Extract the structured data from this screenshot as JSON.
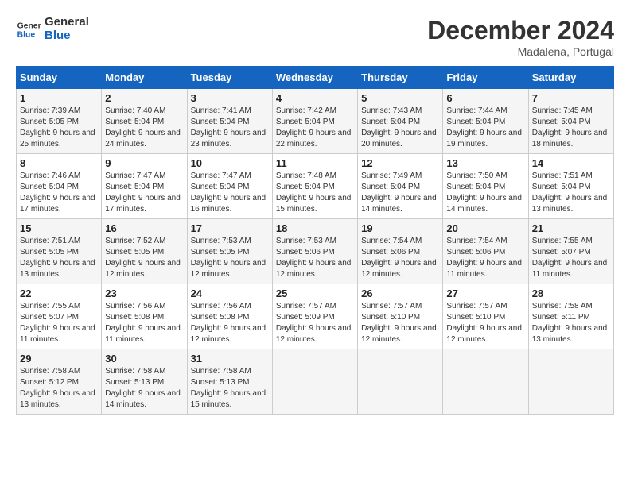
{
  "logo": {
    "text_general": "General",
    "text_blue": "Blue"
  },
  "title": "December 2024",
  "subtitle": "Madalena, Portugal",
  "days_of_week": [
    "Sunday",
    "Monday",
    "Tuesday",
    "Wednesday",
    "Thursday",
    "Friday",
    "Saturday"
  ],
  "weeks": [
    [
      {
        "day": "1",
        "sunrise": "Sunrise: 7:39 AM",
        "sunset": "Sunset: 5:05 PM",
        "daylight": "Daylight: 9 hours and 25 minutes."
      },
      {
        "day": "2",
        "sunrise": "Sunrise: 7:40 AM",
        "sunset": "Sunset: 5:04 PM",
        "daylight": "Daylight: 9 hours and 24 minutes."
      },
      {
        "day": "3",
        "sunrise": "Sunrise: 7:41 AM",
        "sunset": "Sunset: 5:04 PM",
        "daylight": "Daylight: 9 hours and 23 minutes."
      },
      {
        "day": "4",
        "sunrise": "Sunrise: 7:42 AM",
        "sunset": "Sunset: 5:04 PM",
        "daylight": "Daylight: 9 hours and 22 minutes."
      },
      {
        "day": "5",
        "sunrise": "Sunrise: 7:43 AM",
        "sunset": "Sunset: 5:04 PM",
        "daylight": "Daylight: 9 hours and 20 minutes."
      },
      {
        "day": "6",
        "sunrise": "Sunrise: 7:44 AM",
        "sunset": "Sunset: 5:04 PM",
        "daylight": "Daylight: 9 hours and 19 minutes."
      },
      {
        "day": "7",
        "sunrise": "Sunrise: 7:45 AM",
        "sunset": "Sunset: 5:04 PM",
        "daylight": "Daylight: 9 hours and 18 minutes."
      }
    ],
    [
      {
        "day": "8",
        "sunrise": "Sunrise: 7:46 AM",
        "sunset": "Sunset: 5:04 PM",
        "daylight": "Daylight: 9 hours and 17 minutes."
      },
      {
        "day": "9",
        "sunrise": "Sunrise: 7:47 AM",
        "sunset": "Sunset: 5:04 PM",
        "daylight": "Daylight: 9 hours and 17 minutes."
      },
      {
        "day": "10",
        "sunrise": "Sunrise: 7:47 AM",
        "sunset": "Sunset: 5:04 PM",
        "daylight": "Daylight: 9 hours and 16 minutes."
      },
      {
        "day": "11",
        "sunrise": "Sunrise: 7:48 AM",
        "sunset": "Sunset: 5:04 PM",
        "daylight": "Daylight: 9 hours and 15 minutes."
      },
      {
        "day": "12",
        "sunrise": "Sunrise: 7:49 AM",
        "sunset": "Sunset: 5:04 PM",
        "daylight": "Daylight: 9 hours and 14 minutes."
      },
      {
        "day": "13",
        "sunrise": "Sunrise: 7:50 AM",
        "sunset": "Sunset: 5:04 PM",
        "daylight": "Daylight: 9 hours and 14 minutes."
      },
      {
        "day": "14",
        "sunrise": "Sunrise: 7:51 AM",
        "sunset": "Sunset: 5:04 PM",
        "daylight": "Daylight: 9 hours and 13 minutes."
      }
    ],
    [
      {
        "day": "15",
        "sunrise": "Sunrise: 7:51 AM",
        "sunset": "Sunset: 5:05 PM",
        "daylight": "Daylight: 9 hours and 13 minutes."
      },
      {
        "day": "16",
        "sunrise": "Sunrise: 7:52 AM",
        "sunset": "Sunset: 5:05 PM",
        "daylight": "Daylight: 9 hours and 12 minutes."
      },
      {
        "day": "17",
        "sunrise": "Sunrise: 7:53 AM",
        "sunset": "Sunset: 5:05 PM",
        "daylight": "Daylight: 9 hours and 12 minutes."
      },
      {
        "day": "18",
        "sunrise": "Sunrise: 7:53 AM",
        "sunset": "Sunset: 5:06 PM",
        "daylight": "Daylight: 9 hours and 12 minutes."
      },
      {
        "day": "19",
        "sunrise": "Sunrise: 7:54 AM",
        "sunset": "Sunset: 5:06 PM",
        "daylight": "Daylight: 9 hours and 12 minutes."
      },
      {
        "day": "20",
        "sunrise": "Sunrise: 7:54 AM",
        "sunset": "Sunset: 5:06 PM",
        "daylight": "Daylight: 9 hours and 11 minutes."
      },
      {
        "day": "21",
        "sunrise": "Sunrise: 7:55 AM",
        "sunset": "Sunset: 5:07 PM",
        "daylight": "Daylight: 9 hours and 11 minutes."
      }
    ],
    [
      {
        "day": "22",
        "sunrise": "Sunrise: 7:55 AM",
        "sunset": "Sunset: 5:07 PM",
        "daylight": "Daylight: 9 hours and 11 minutes."
      },
      {
        "day": "23",
        "sunrise": "Sunrise: 7:56 AM",
        "sunset": "Sunset: 5:08 PM",
        "daylight": "Daylight: 9 hours and 11 minutes."
      },
      {
        "day": "24",
        "sunrise": "Sunrise: 7:56 AM",
        "sunset": "Sunset: 5:08 PM",
        "daylight": "Daylight: 9 hours and 12 minutes."
      },
      {
        "day": "25",
        "sunrise": "Sunrise: 7:57 AM",
        "sunset": "Sunset: 5:09 PM",
        "daylight": "Daylight: 9 hours and 12 minutes."
      },
      {
        "day": "26",
        "sunrise": "Sunrise: 7:57 AM",
        "sunset": "Sunset: 5:10 PM",
        "daylight": "Daylight: 9 hours and 12 minutes."
      },
      {
        "day": "27",
        "sunrise": "Sunrise: 7:57 AM",
        "sunset": "Sunset: 5:10 PM",
        "daylight": "Daylight: 9 hours and 12 minutes."
      },
      {
        "day": "28",
        "sunrise": "Sunrise: 7:58 AM",
        "sunset": "Sunset: 5:11 PM",
        "daylight": "Daylight: 9 hours and 13 minutes."
      }
    ],
    [
      {
        "day": "29",
        "sunrise": "Sunrise: 7:58 AM",
        "sunset": "Sunset: 5:12 PM",
        "daylight": "Daylight: 9 hours and 13 minutes."
      },
      {
        "day": "30",
        "sunrise": "Sunrise: 7:58 AM",
        "sunset": "Sunset: 5:13 PM",
        "daylight": "Daylight: 9 hours and 14 minutes."
      },
      {
        "day": "31",
        "sunrise": "Sunrise: 7:58 AM",
        "sunset": "Sunset: 5:13 PM",
        "daylight": "Daylight: 9 hours and 15 minutes."
      },
      null,
      null,
      null,
      null
    ]
  ]
}
